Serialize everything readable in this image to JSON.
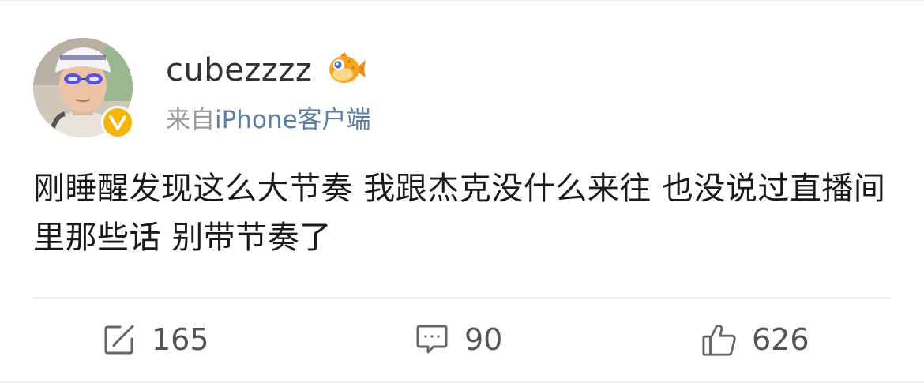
{
  "post": {
    "username": "cubezzzz",
    "source_prefix": "来自",
    "source_client": "iPhone客户端",
    "text": "刚睡醒发现这么大节奏 我跟杰克没什么来往 也没说过直播间里那些话 别带节奏了"
  },
  "actions": {
    "repost_count": "165",
    "comment_count": "90",
    "like_count": "626"
  },
  "colors": {
    "verified_badge": "#f7b500",
    "client_link": "#5b7ea8",
    "username": "#333333",
    "icon_gray": "#555555"
  },
  "icons": {
    "verified": "verified-v-icon",
    "member": "pufferfish-member-icon",
    "repost": "repost-icon",
    "comment": "comment-icon",
    "like": "thumbs-up-icon"
  }
}
